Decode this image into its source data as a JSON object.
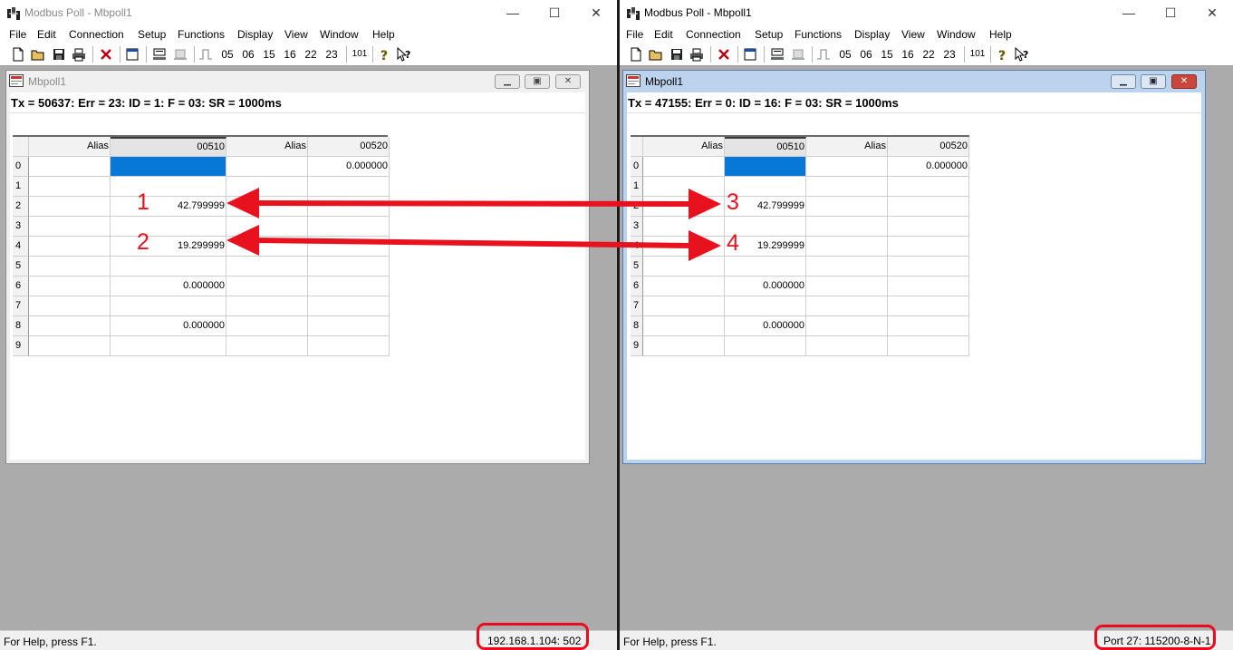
{
  "left": {
    "window_title": "Modbus Poll - Mbpoll1",
    "menu": [
      "File",
      "Edit",
      "Connection",
      "Setup",
      "Functions",
      "Display",
      "View",
      "Window",
      "Help"
    ],
    "toolbar": {
      "codes": [
        "05",
        "06",
        "15",
        "16",
        "22",
        "23"
      ],
      "counter": "101"
    },
    "mdi": {
      "title": "Mbpoll1",
      "status": "Tx = 50637: Err = 23: ID = 1: F = 03: SR = 1000ms",
      "columns": [
        "Alias",
        "00510",
        "Alias",
        "00520"
      ],
      "rows": [
        {
          "index": "0",
          "v510": "",
          "v520": "0.000000"
        },
        {
          "index": "1",
          "v510": "",
          "v520": ""
        },
        {
          "index": "2",
          "v510": "42.799999",
          "v520": ""
        },
        {
          "index": "3",
          "v510": "",
          "v520": ""
        },
        {
          "index": "4",
          "v510": "19.299999",
          "v520": ""
        },
        {
          "index": "5",
          "v510": "",
          "v520": ""
        },
        {
          "index": "6",
          "v510": "0.000000",
          "v520": ""
        },
        {
          "index": "7",
          "v510": "",
          "v520": ""
        },
        {
          "index": "8",
          "v510": "0.000000",
          "v520": ""
        },
        {
          "index": "9",
          "v510": "",
          "v520": ""
        }
      ]
    },
    "statusbar": {
      "help": "For Help, press F1.",
      "connection": "192.168.1.104: 502"
    }
  },
  "right": {
    "window_title": "Modbus Poll - Mbpoll1",
    "menu": [
      "File",
      "Edit",
      "Connection",
      "Setup",
      "Functions",
      "Display",
      "View",
      "Window",
      "Help"
    ],
    "toolbar": {
      "codes": [
        "05",
        "06",
        "15",
        "16",
        "22",
        "23"
      ],
      "counter": "101"
    },
    "mdi": {
      "title": "Mbpoll1",
      "status": "Tx = 47155: Err = 0: ID = 16: F = 03: SR = 1000ms",
      "columns": [
        "Alias",
        "00510",
        "Alias",
        "00520"
      ],
      "rows": [
        {
          "index": "0",
          "v510": "",
          "v520": "0.000000"
        },
        {
          "index": "1",
          "v510": "",
          "v520": ""
        },
        {
          "index": "2",
          "v510": "42.799999",
          "v520": ""
        },
        {
          "index": "3",
          "v510": "",
          "v520": ""
        },
        {
          "index": "4",
          "v510": "19.299999",
          "v520": ""
        },
        {
          "index": "5",
          "v510": "",
          "v520": ""
        },
        {
          "index": "6",
          "v510": "0.000000",
          "v520": ""
        },
        {
          "index": "7",
          "v510": "",
          "v520": ""
        },
        {
          "index": "8",
          "v510": "0.000000",
          "v520": ""
        },
        {
          "index": "9",
          "v510": "",
          "v520": ""
        }
      ]
    },
    "statusbar": {
      "help": "For Help, press F1.",
      "connection": "Port 27: 115200-8-N-1"
    }
  },
  "annotations": {
    "labels": [
      "1",
      "2",
      "3",
      "4"
    ],
    "color": "#e8111e"
  },
  "colors": {
    "selection": "#0878d7",
    "highlight": "#ee0a1e",
    "workspace": "#ababab"
  }
}
